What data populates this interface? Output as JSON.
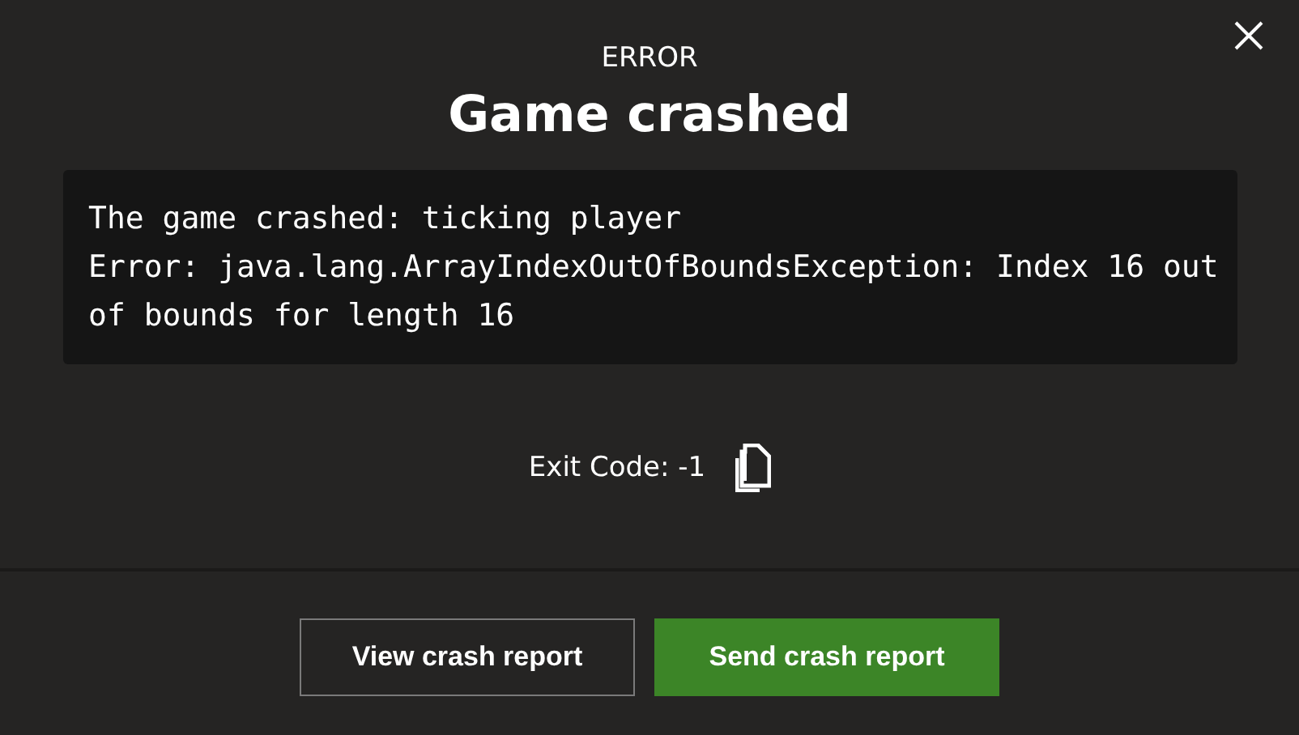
{
  "dialog": {
    "eyebrow": "ERROR",
    "title": "Game crashed",
    "log_lines": [
      "The game crashed: ticking player",
      "Error: java.lang.ArrayIndexOutOfBoundsException: Index 16 out of bounds for length 16"
    ],
    "exit_code": "Exit Code: -1"
  },
  "buttons": [
    {
      "label": "View crash report",
      "kind": "secondary"
    },
    {
      "label": "Send crash report",
      "kind": "primary"
    }
  ]
}
